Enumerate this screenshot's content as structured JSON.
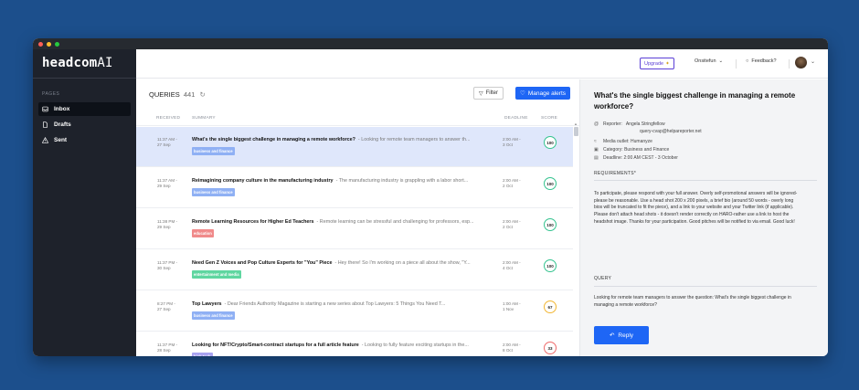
{
  "window": {
    "colors": {
      "close": "#ff5f56",
      "minimize": "#ffbd2e",
      "zoom": "#27c93f"
    }
  },
  "sidebar": {
    "brand_bold": "headcom",
    "brand_suffix": "AI",
    "section_label": "PAGES",
    "items": [
      {
        "label": "Inbox",
        "icon": "inbox-icon",
        "active": true
      },
      {
        "label": "Drafts",
        "icon": "file-icon",
        "active": false
      },
      {
        "label": "Sent",
        "icon": "alert-icon",
        "active": false
      }
    ]
  },
  "topbar": {
    "upgrade_label": "Upgrade",
    "workspace_label": "Onsitefun",
    "feedback_label": "Feedback?"
  },
  "queries": {
    "heading": "QUERIES",
    "count": "441",
    "filter_label": "Filter",
    "manage_label": "Manage alerts",
    "columns": {
      "received": "RECEIVED",
      "summary": "SUMMARY",
      "deadline": "DEADLINE",
      "score": "SCORE"
    },
    "rows": [
      {
        "received1": "11:37 AM -",
        "received2": "27 Sep",
        "title": "What's the single biggest challenge in managing a remote workforce?",
        "snippet": "- Looking for remote team managers to answer th...",
        "tag": "business and finance",
        "tag_color": "#8fb0f4",
        "deadline1": "2:00 AM -",
        "deadline2": "3 Oct",
        "score": "100",
        "score_color": "#34c38f",
        "selected": true
      },
      {
        "received1": "11:37 AM -",
        "received2": "29 Sep",
        "title": "Reimagining company culture in the manufacturing industry",
        "snippet": "- The manufacturing industry is grappling with a labor short...",
        "tag": "business and finance",
        "tag_color": "#8fb0f4",
        "deadline1": "2:00 AM -",
        "deadline2": "2 Oct",
        "score": "100",
        "score_color": "#34c38f",
        "selected": false
      },
      {
        "received1": "11:38 PM -",
        "received2": "29 Sep",
        "title": "Remote Learning Resources for Higher Ed Teachers",
        "snippet": "- Remote learning can be stressful and challenging for professors, esp...",
        "tag": "education",
        "tag_color": "#f08a8a",
        "deadline1": "2:00 AM -",
        "deadline2": "2 Oct",
        "score": "100",
        "score_color": "#34c38f",
        "selected": false
      },
      {
        "received1": "11:37 PM -",
        "received2": "30 Sep",
        "title": "Need Gen Z Voices and Pop Culture Experts for \"You\" Piece",
        "snippet": "- Hey there! So I'm working on a piece all about the show, \"Y...",
        "tag": "entertainment and media",
        "tag_color": "#5fd6a0",
        "deadline1": "2:00 AM -",
        "deadline2": "4 Oct",
        "score": "100",
        "score_color": "#34c38f",
        "selected": false
      },
      {
        "received1": "8:27 PM -",
        "received2": "27 Sep",
        "title": "Top Lawyers",
        "snippet": "- Dear Friends Authority Magazine is starting a new series about Top Lawyers: 5 Things You Need T...",
        "tag": "business and finance",
        "tag_color": "#8fb0f4",
        "deadline1": "1:00 AM -",
        "deadline2": "1 Nov",
        "score": "67",
        "score_color": "#f2b632",
        "selected": false
      },
      {
        "received1": "11:37 PM -",
        "received2": "28 Sep",
        "title": "Looking for NFT/Crypto/Smart-contract startups for a full article feature",
        "snippet": "- Looking to fully feature exciting startups in the...",
        "tag": "high tech",
        "tag_color": "#a9a3f0",
        "deadline1": "2:00 AM -",
        "deadline2": "8 Oct",
        "score": "33",
        "score_color": "#ef6b6b",
        "selected": false
      }
    ]
  },
  "detail": {
    "title": "What's the single biggest challenge in managing a remote workforce?",
    "reporter_label": "Reporter:",
    "reporter_name": "Angela Stringfellow",
    "reporter_email": "query-cvap@helpareporter.net",
    "outlet": "Media outlet: Humanyze",
    "category": "Category: Business and Finance",
    "deadline": "Deadline: 2:00 AM CEST - 3 October",
    "requirements_heading": "REQUIREMENTS*",
    "requirements_text": "To participate, please respond with your full answer. Overly self-promotional answers will be ignored-please be reasonable. Use a head shot 200 x 200 pixels, a brief bio (around 50 words - overly long bios will be truncated to fit the piece), and a link to your website and your Twitter link (if applicable). Please don't attach head shots - it doesn't render correctly on HARO-rather use a link to host the headshot image. Thanks for your participation. Good pitches will be notified to via email. Good luck!",
    "query_heading": "QUERY",
    "query_text": "Looking for remote team managers to answer the question: What's the single biggest challenge in managing a remote workforce?",
    "reply_label": "Reply"
  }
}
